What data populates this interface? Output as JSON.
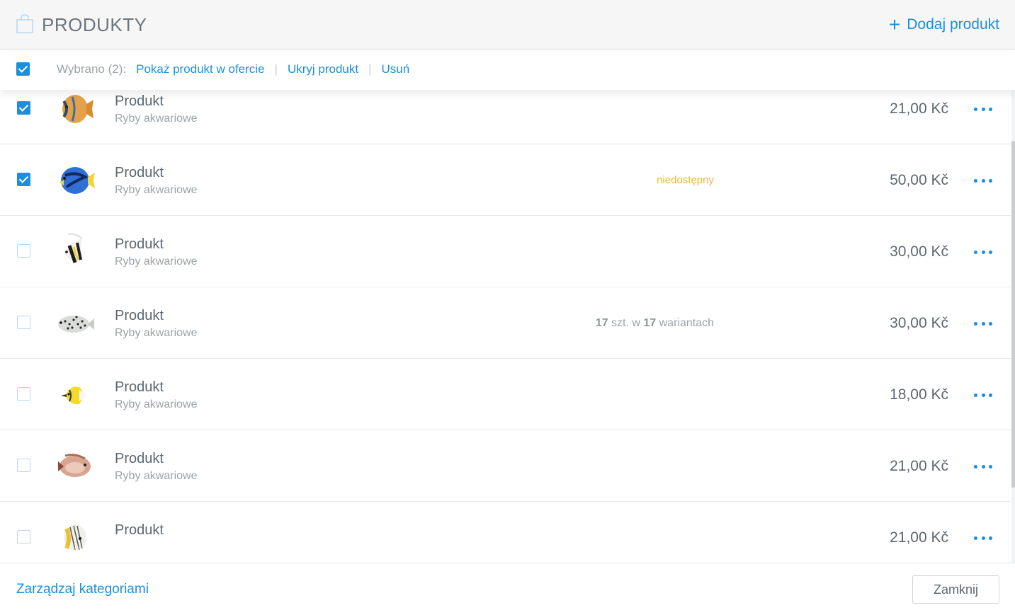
{
  "header": {
    "title": "PRODUKTY",
    "add_label": "Dodaj produkt",
    "icon": "shopping-bag-icon"
  },
  "selection": {
    "checked": true,
    "label": "Wybrano (2):",
    "actions": [
      "Pokaż produkt w ofercie",
      "Ukryj produkt",
      "Usuń"
    ]
  },
  "products": [
    {
      "name": "Produkt",
      "category": "Ryby akwariowe",
      "price": "21,00 Kč",
      "checked": true,
      "status": "",
      "fish": "angelfish-orange"
    },
    {
      "name": "Produkt",
      "category": "Ryby akwariowe",
      "price": "50,00 Kč",
      "checked": true,
      "status": "niedostępny",
      "fish": "blue-tang"
    },
    {
      "name": "Produkt",
      "category": "Ryby akwariowe",
      "price": "30,00 Kč",
      "checked": false,
      "status": "",
      "fish": "bannerfish"
    },
    {
      "name": "Produkt",
      "category": "Ryby akwariowe",
      "price": "30,00 Kč",
      "checked": false,
      "status": "",
      "stock": {
        "count": "17",
        "mid": " szt. w ",
        "variants": "17",
        "suffix": " wariantach"
      },
      "fish": "spotted-grouper"
    },
    {
      "name": "Produkt",
      "category": "Ryby akwariowe",
      "price": "18,00 Kč",
      "checked": false,
      "status": "",
      "fish": "yellow-butterflyfish"
    },
    {
      "name": "Produkt",
      "category": "Ryby akwariowe",
      "price": "21,00 Kč",
      "checked": false,
      "status": "",
      "fish": "brown-rabbitfish"
    },
    {
      "name": "Produkt",
      "category": "",
      "price": "21,00 Kč",
      "checked": false,
      "status": "",
      "fish": "threadfin-butterflyfish"
    }
  ],
  "footer": {
    "manage_label": "Zarządzaj kategoriami",
    "close_label": "Zamknij"
  },
  "colors": {
    "accent": "#1b8fdb",
    "warning": "#f0b143",
    "muted": "#9aa3aa",
    "text": "#5c6770"
  }
}
